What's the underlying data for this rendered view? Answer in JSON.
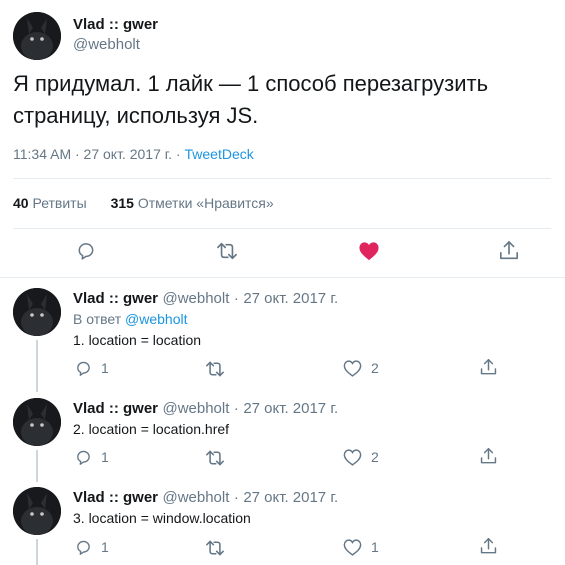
{
  "main": {
    "author_name": "Vlad :: gwer",
    "author_handle": "@webholt",
    "text": "Я придумал. 1 лайк — 1 способ перезагрузить страницу, используя JS.",
    "time_date": "11:34 AM · 27 окт. 2017 г. ·",
    "client": "TweetDeck",
    "retweets_count": "40",
    "retweets_label": "Ретвиты",
    "likes_count": "315",
    "likes_label": "Отметки «Нравится»"
  },
  "replies": [
    {
      "name": "Vlad :: gwer",
      "handle": "@webholt",
      "sep": "·",
      "date": "27 окт. 2017 г.",
      "reply_prefix": "В ответ",
      "reply_to": "@webholt",
      "text": "1. location = location",
      "reply_count": "1",
      "like_count": "2"
    },
    {
      "name": "Vlad :: gwer",
      "handle": "@webholt",
      "sep": "·",
      "date": "27 окт. 2017 г.",
      "text": "2. location = location.href",
      "reply_count": "1",
      "like_count": "2"
    },
    {
      "name": "Vlad :: gwer",
      "handle": "@webholt",
      "sep": "·",
      "date": "27 окт. 2017 г.",
      "text": "3. location = window.location",
      "reply_count": "1",
      "like_count": "1"
    }
  ],
  "colors": {
    "like_active": "#e0245e",
    "icon": "#657786",
    "link": "#1b95e0"
  },
  "icons": [
    "reply-icon",
    "retweet-icon",
    "like-icon",
    "share-icon"
  ]
}
